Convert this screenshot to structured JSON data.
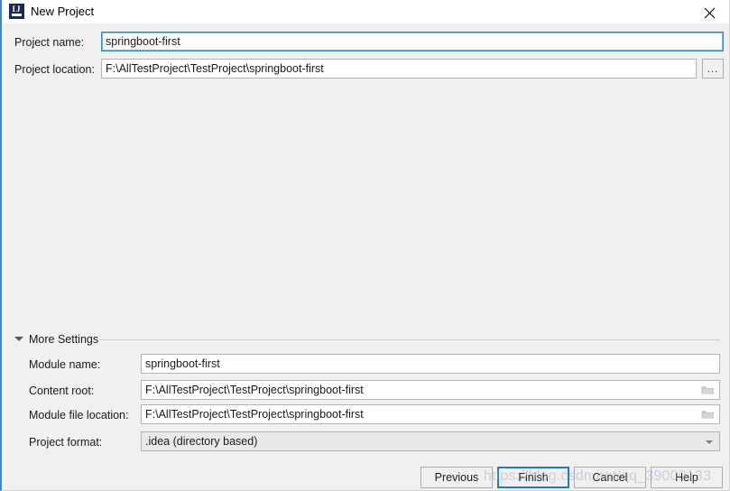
{
  "window": {
    "title": "New Project",
    "app_icon": "intellij-idea-icon",
    "app_icon_letters": "IJ",
    "close_icon": "close-icon",
    "accent_color": "#2d8ce0",
    "background_color": "#f0f0f0"
  },
  "form": {
    "project_name": {
      "label": "Project name:",
      "value": "springboot-first",
      "placeholder": "",
      "focused": true
    },
    "project_location": {
      "label": "Project location:",
      "value": "F:\\AllTestProject\\TestProject\\springboot-first",
      "placeholder": "",
      "browse_label": "...",
      "browse_icon": "ellipsis-icon"
    }
  },
  "more_settings": {
    "label": "More Settings",
    "expanded": true,
    "toggle_icon": "triangle-down-icon",
    "fields": {
      "module_name": {
        "label": "Module name:",
        "value": "springboot-first",
        "placeholder": ""
      },
      "content_root": {
        "label": "Content root:",
        "value": "F:\\AllTestProject\\TestProject\\springboot-first",
        "placeholder": "",
        "browse_icon": "folder-icon"
      },
      "module_file_location": {
        "label": "Module file location:",
        "value": "F:\\AllTestProject\\TestProject\\springboot-first",
        "placeholder": "",
        "browse_icon": "folder-icon"
      },
      "project_format": {
        "label": "Project format:",
        "value": ".idea (directory based)",
        "dropdown_icon": "chevron-down-icon"
      }
    }
  },
  "buttons": {
    "previous": "Previous",
    "finish": "Finish",
    "cancel": "Cancel",
    "help": "Help",
    "default_button": "Finish",
    "default_border_color": "#1a7bd4"
  },
  "watermark": {
    "text": "https://blog.csdn.net/qq_39000133"
  }
}
